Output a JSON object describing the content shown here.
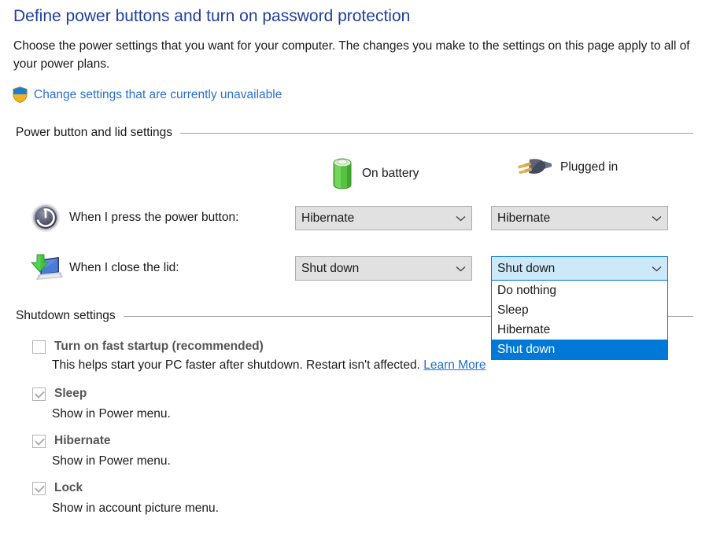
{
  "header": {
    "title": "Define power buttons and turn on password protection",
    "description": "Choose the power settings that you want for your computer. The changes you make to the settings on this page apply to all of your power plans.",
    "uac_link": "Change settings that are currently unavailable",
    "title_color": "#1f3f9e",
    "link_color": "#2b6fd4"
  },
  "power_group": {
    "label": "Power button and lid settings",
    "columns": [
      {
        "label": "On battery",
        "icon": "battery-icon"
      },
      {
        "label": "Plugged in",
        "icon": "plug-icon"
      }
    ],
    "rows": [
      {
        "label": "When I press the power button:",
        "icon": "power-button-icon",
        "on_battery_value": "Hibernate",
        "plugged_in_value": "Hibernate"
      },
      {
        "label": "When I close the lid:",
        "icon": "laptop-lid-icon",
        "on_battery_value": "Shut down",
        "plugged_in_value": "Shut down"
      }
    ]
  },
  "dropdown": {
    "open": true,
    "owner": "lid-plugged-in",
    "options": [
      "Do nothing",
      "Sleep",
      "Hibernate",
      "Shut down"
    ],
    "selected": "Shut down",
    "highlight_color": "#0078d7",
    "focus_background": "#cde8f9"
  },
  "shutdown_group": {
    "label": "Shutdown settings",
    "items": [
      {
        "label": "Turn on fast startup (recommended)",
        "checked": false,
        "disabled": true,
        "description": "This helps start your PC faster after shutdown. Restart isn't affected.",
        "link": "Learn More"
      },
      {
        "label": "Sleep",
        "checked": true,
        "disabled": true,
        "description": "Show in Power menu.",
        "link": ""
      },
      {
        "label": "Hibernate",
        "checked": true,
        "disabled": true,
        "description": "Show in Power menu.",
        "link": ""
      },
      {
        "label": "Lock",
        "checked": true,
        "disabled": true,
        "description": "Show in account picture menu.",
        "link": ""
      }
    ]
  }
}
